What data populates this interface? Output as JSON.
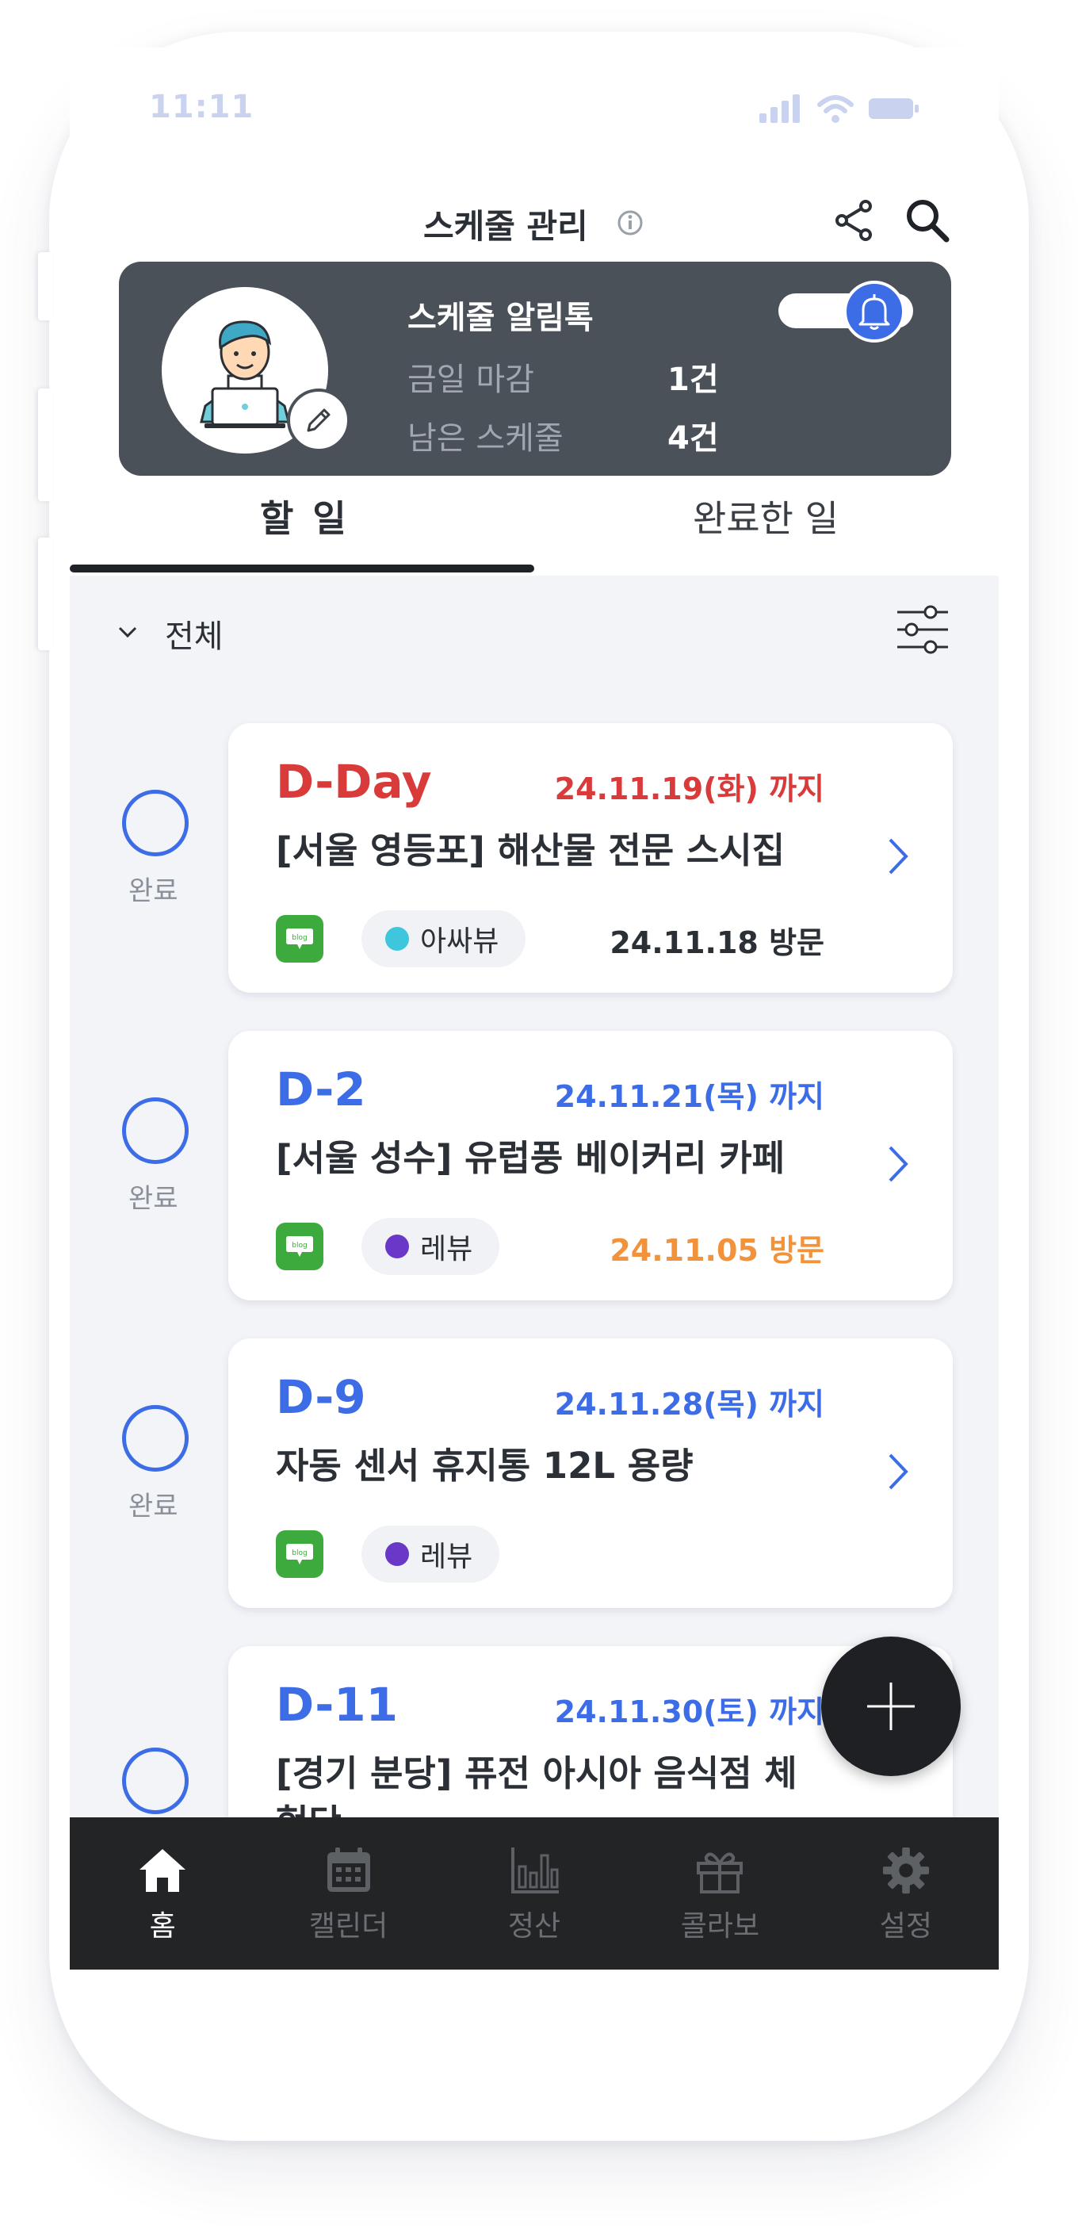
{
  "status_bar": {
    "time": "11:11"
  },
  "header": {
    "title": "스케줄 관리"
  },
  "profile": {
    "title": "스케줄 알림톡",
    "rows": [
      {
        "label": "금일 마감",
        "value": "1건"
      },
      {
        "label": "남은 스케줄",
        "value": "4건"
      }
    ],
    "alarm_on": true
  },
  "tabs": [
    {
      "label": "할 일",
      "active": true
    },
    {
      "label": "완료한 일",
      "active": false
    }
  ],
  "filter": {
    "label": "전체"
  },
  "complete_label": "완료",
  "items": [
    {
      "dday": "D-Day",
      "due": "24.11.19(화) 까지",
      "title": "[서울 영등포] 해산물 전문 스시집",
      "channel": "blog",
      "tag": "아싸뷰",
      "visit": "24.11.18 방문"
    },
    {
      "dday": "D-2",
      "due": "24.11.21(목) 까지",
      "title": "[서울 성수] 유럽풍 베이커리 카페",
      "channel": "blog",
      "tag": "레뷰",
      "visit": "24.11.05 방문"
    },
    {
      "dday": "D-9",
      "due": "24.11.28(목) 까지",
      "title": "자동 센서 휴지통 12L 용량",
      "channel": "blog",
      "tag": "레뷰",
      "visit": ""
    },
    {
      "dday": "D-11",
      "due": "24.11.30(토) 까지",
      "title": "[경기 분당] 퓨전 아시아 음식점 체험단",
      "channel": "",
      "tag": "",
      "visit": ""
    }
  ],
  "nav": [
    {
      "label": "홈",
      "icon": "home-icon",
      "active": true
    },
    {
      "label": "캘린더",
      "icon": "calendar-icon",
      "active": false
    },
    {
      "label": "정산",
      "icon": "chart-icon",
      "active": false
    },
    {
      "label": "콜라보",
      "icon": "gift-icon",
      "active": false
    },
    {
      "label": "설정",
      "icon": "gear-icon",
      "active": false
    }
  ],
  "colors": {
    "urgent": "#d93a3a",
    "accent": "#3d6ce7",
    "visit_default": "#2b2f36",
    "visit_highlight": "#f2923a",
    "tag_cyan": "#3ec6dc",
    "tag_purple": "#6a38c9"
  }
}
